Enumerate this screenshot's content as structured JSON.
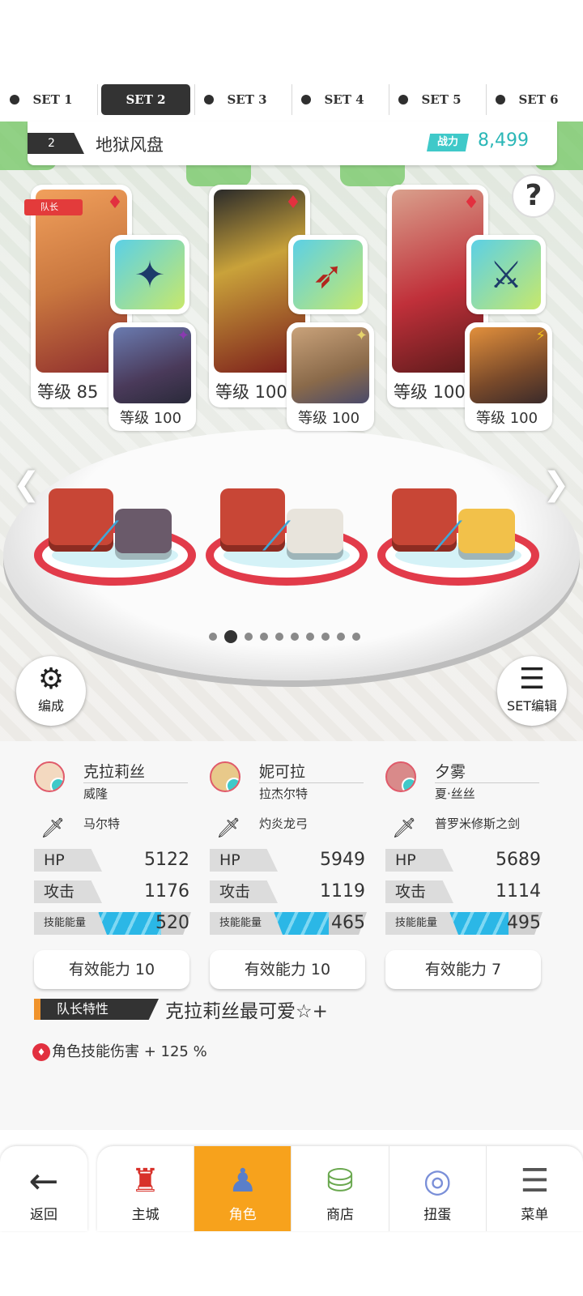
{
  "set_tabs": [
    {
      "label": "SET 1",
      "active": false
    },
    {
      "label": "SET 2",
      "active": true
    },
    {
      "label": "SET 3",
      "active": false
    },
    {
      "label": "SET 4",
      "active": false
    },
    {
      "label": "SET 5",
      "active": false
    },
    {
      "label": "SET 6",
      "active": false
    }
  ],
  "team": {
    "number": "2",
    "name": "地狱风盘",
    "power_label": "战力",
    "power_value": "8,499"
  },
  "help_label": "?",
  "leader_badge": "队长",
  "cards": [
    {
      "level": "等级 85",
      "sub_level": "等级 100",
      "weapon_icon": "spear-icon"
    },
    {
      "level": "等级 100",
      "sub_level": "等级 100",
      "weapon_icon": "bow-icon"
    },
    {
      "level": "等级 100",
      "sub_level": "等级 100",
      "weapon_icon": "sword-icon"
    }
  ],
  "page_dots": {
    "count": 10,
    "active_index": 1
  },
  "buttons": {
    "formation": "编成",
    "set_edit": "SET编辑"
  },
  "heroes": [
    {
      "name": "克拉莉丝",
      "sub": "威隆",
      "weapon": "马尔特",
      "hp_label": "HP",
      "hp": "5122",
      "atk_label": "攻击",
      "atk": "1176",
      "energy_label": "技能能量",
      "energy": "520",
      "energy_fraction": 0.7,
      "effective": "有效能力 10"
    },
    {
      "name": "妮可拉",
      "sub": "拉杰尔特",
      "weapon": "灼炎龙弓",
      "hp_label": "HP",
      "hp": "5949",
      "atk_label": "攻击",
      "atk": "1119",
      "energy_label": "技能能量",
      "energy": "465",
      "energy_fraction": 0.62,
      "effective": "有效能力 10"
    },
    {
      "name": "夕雾",
      "sub": "夏·丝丝",
      "weapon": "普罗米修斯之剑",
      "hp_label": "HP",
      "hp": "5689",
      "atk_label": "攻击",
      "atk": "1114",
      "energy_label": "技能能量",
      "energy": "495",
      "energy_fraction": 0.66,
      "effective": "有效能力 7"
    }
  ],
  "leader_trait": {
    "label": "队长特性",
    "skill": "克拉莉丝最可爱☆+",
    "bonus": "角色技能伤害 + 125 %"
  },
  "nav": {
    "back": "返回",
    "items": [
      {
        "label": "主城",
        "icon": "castle-icon",
        "active": false
      },
      {
        "label": "角色",
        "icon": "character-icon",
        "active": true
      },
      {
        "label": "商店",
        "icon": "shop-icon",
        "active": false
      },
      {
        "label": "扭蛋",
        "icon": "gacha-icon",
        "active": false
      },
      {
        "label": "菜单",
        "icon": "menu-icon",
        "active": false
      }
    ]
  },
  "colors": {
    "accent_teal": "#3fc9c9",
    "active_tab": "#f7a21c",
    "element_red": "#e2303f"
  }
}
